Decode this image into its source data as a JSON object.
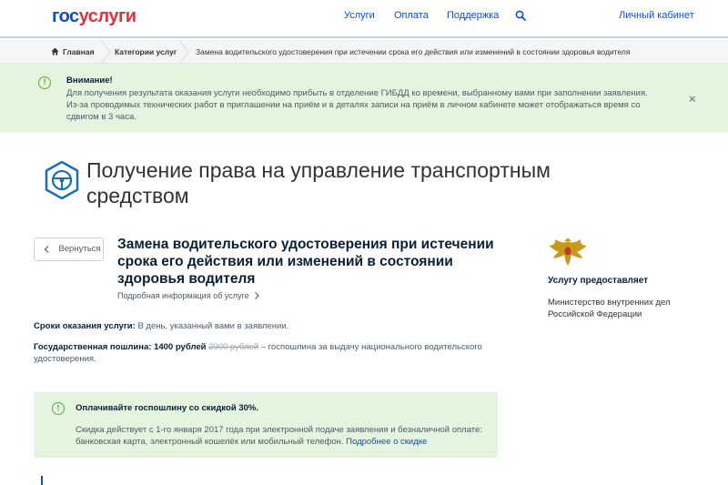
{
  "header": {
    "logo_part1": "гос",
    "logo_part2": "услуги",
    "nav": [
      "Услуги",
      "Оплата",
      "Поддержка"
    ],
    "search_icon": "search-icon",
    "cabinet": "Личный кабинет"
  },
  "breadcrumbs": {
    "home": "Главная",
    "categories": "Категории услуг",
    "current": "Замена водительского удостоверения при истечении срока его действия или изменений в состоянии здоровья водителя"
  },
  "alert": {
    "title": "Внимание!",
    "line1": "Для получения результата оказания услуги необходимо прибыть в отделение ГИБДД ко времени, выбранному вами при заполнении заявления.",
    "line2": "Из-за проводимых технических работ в приглашении на приём и в деталях записи на приём в личном кабинете может отображаться время со сдвигом в 3 часа.",
    "icon": "info-circle-icon",
    "close_glyph": "×",
    "accent": "#64a444"
  },
  "page_title": "Получение права на управление транспортным средством",
  "service": {
    "back_label": "Вернуться",
    "title": "Замена водительского удостоверения при истечении срока его действия или изменений в состоянии здоровья водителя",
    "details_link": "Подробная информация об услуге",
    "terms_label": "Сроки оказания услуги:",
    "terms_value": "В день, указанный вами в заявлении.",
    "fee_label": "Государственная пошлина:",
    "fee_value": "1400 рублей",
    "fee_old": "2000 рублей",
    "fee_desc": "– госпошлина за выдачу национального водительского удостоверения."
  },
  "discount": {
    "title": "Оплачивайте госпошлину со скидкой 30%.",
    "text": "Скидка действует с 1-го января 2017 года при электронной подаче заявления и безналичной оплате: банковская карта, электронный кошелёк или мобильный телефон.",
    "link": "Подробнее о скидке"
  },
  "provider": {
    "title": "Услугу предоставляет",
    "name": "Министерство внутренних дел Российской Федерации"
  },
  "colors": {
    "brand_blue": "#0d4cd3",
    "brand_red": "#e3303c",
    "alert_bg": "#e4f4de"
  }
}
